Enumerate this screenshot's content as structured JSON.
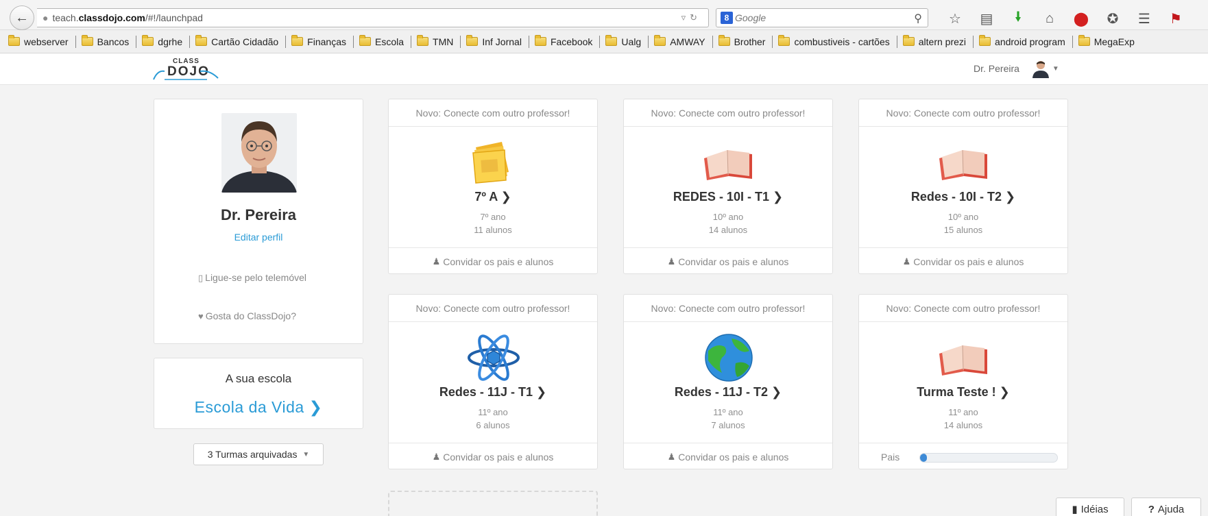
{
  "browser": {
    "url_prefix": "teach.",
    "url_domain": "classdojo.com",
    "url_path": "/#!/launchpad",
    "search_engine_badge": "8",
    "search_placeholder": "Google",
    "bookmarks": [
      "webserver",
      "Bancos",
      "dgrhe",
      "Cartão Cidadão",
      "Finanças",
      "Escola",
      "TMN",
      "Inf Jornal",
      "Facebook",
      "Ualg",
      "AMWAY",
      "Brother",
      "combustiveis - cartões",
      "altern prezi",
      "android program",
      "MegaExp"
    ]
  },
  "header": {
    "logo_small": "CLASS",
    "logo_big": "DOJO",
    "user_name": "Dr. Pereira"
  },
  "profile": {
    "name": "Dr. Pereira",
    "edit_label": "Editar perfil",
    "phone_label": "Ligue-se pelo telemóvel",
    "like_label": "Gosta do ClassDojo?"
  },
  "school": {
    "label": "A sua escola",
    "name": "Escola da Vida"
  },
  "archive_button": "3 Turmas arquivadas",
  "classes": [
    {
      "banner": "Novo: Conecte com outro professor!",
      "title": "7º A",
      "grade": "7º ano",
      "count": "11 alunos",
      "footer": "Convidar os pais e alunos",
      "icon": "folder-icon"
    },
    {
      "banner": "Novo: Conecte com outro professor!",
      "title": "REDES - 10I - T1",
      "grade": "10º ano",
      "count": "14 alunos",
      "footer": "Convidar os pais e alunos",
      "icon": "book-icon"
    },
    {
      "banner": "Novo: Conecte com outro professor!",
      "title": "Redes - 10I - T2",
      "grade": "10º ano",
      "count": "15 alunos",
      "footer": "Convidar os pais e alunos",
      "icon": "book-icon"
    },
    {
      "banner": "Novo: Conecte com outro professor!",
      "title": "Redes - 11J - T1",
      "grade": "11º ano",
      "count": "6 alunos",
      "footer": "Convidar os pais e alunos",
      "icon": "atom-icon"
    },
    {
      "banner": "Novo: Conecte com outro professor!",
      "title": "Redes - 11J - T2",
      "grade": "11º ano",
      "count": "7 alunos",
      "footer": "Convidar os pais e alunos",
      "icon": "globe-icon"
    },
    {
      "banner": "Novo: Conecte com outro professor!",
      "title": "Turma Teste !",
      "grade": "11º ano",
      "count": "14 alunos",
      "parents_label": "Pais",
      "parents_progress": 0.05,
      "icon": "book-icon"
    }
  ],
  "help": {
    "ideas_label": "Idéias",
    "help_label": "Ajuda"
  },
  "colors": {
    "accent": "#2a9bd6",
    "progress": "#3d8ad6"
  }
}
